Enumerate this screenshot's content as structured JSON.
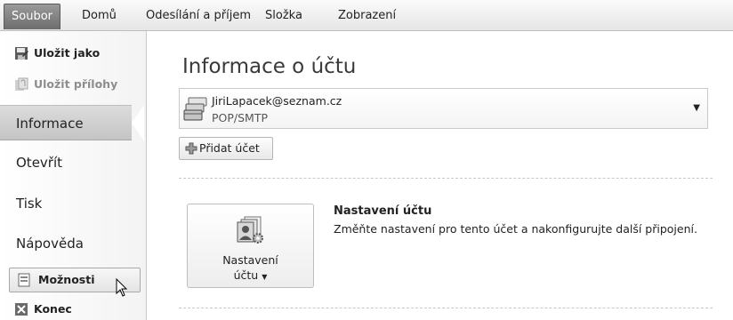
{
  "ribbon": {
    "tabs": [
      "Soubor",
      "Domů",
      "Odesílání a příjem",
      "Složka",
      "Zobrazení"
    ]
  },
  "backstage": {
    "commands_top": [
      {
        "label": "Uložit jako",
        "icon": "save-as-icon",
        "enabled": true
      },
      {
        "label": "Uložit přílohy",
        "icon": "save-attachments-icon",
        "enabled": false
      }
    ],
    "nav_items": [
      {
        "label": "Informace",
        "active": true
      },
      {
        "label": "Otevřít",
        "active": false
      },
      {
        "label": "Tisk",
        "active": false
      },
      {
        "label": "Nápověda",
        "active": false
      }
    ],
    "commands_bottom": [
      {
        "label": "Možnosti",
        "icon": "options-icon",
        "hovered": true
      },
      {
        "label": "Konec",
        "icon": "exit-icon"
      }
    ]
  },
  "main": {
    "title": "Informace o účtu",
    "account": {
      "email": "JiriLapacek@seznam.cz",
      "type": "POP/SMTP"
    },
    "add_account_label": "Přidat účet",
    "settings": {
      "button_line1": "Nastavení",
      "button_line2": "účtu",
      "heading": "Nastavení účtu",
      "description": "Změňte nastavení pro tento účet a nakonfigurujte další připojení."
    }
  }
}
